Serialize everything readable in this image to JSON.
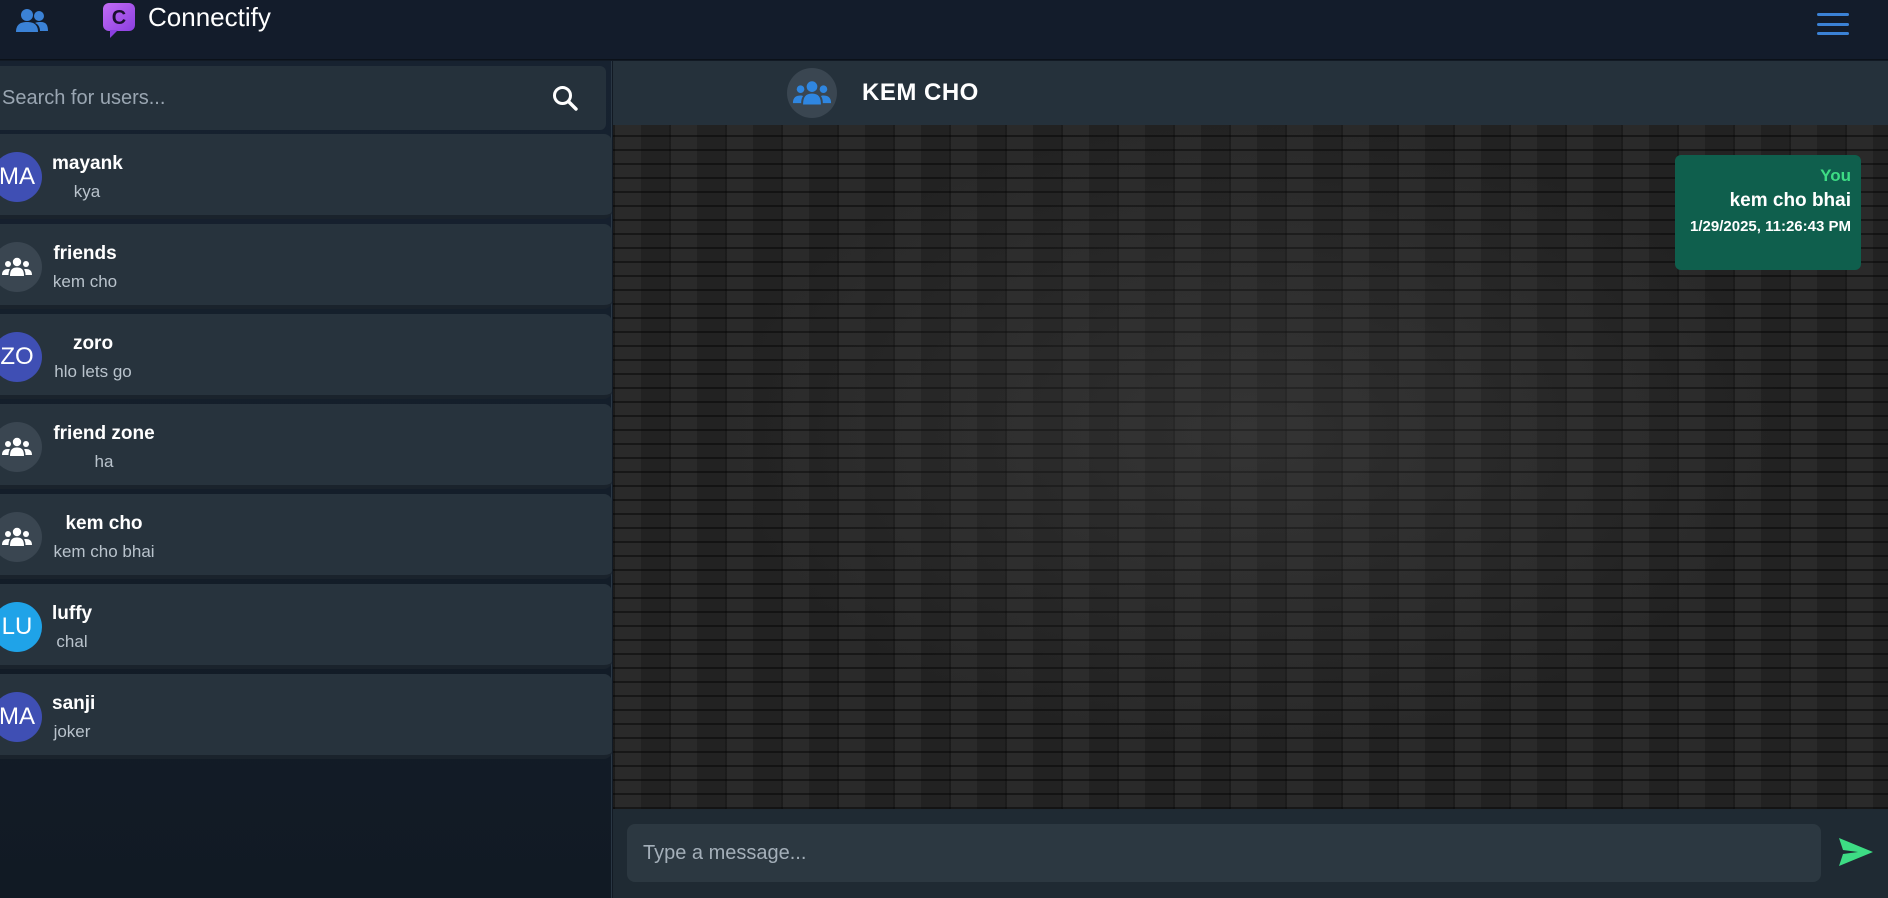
{
  "app": {
    "title": "Connectify",
    "logo_letter": "C",
    "accent_color": "#3b82d6",
    "logo_color": "#a855f7"
  },
  "search": {
    "placeholder": "Search for users..."
  },
  "chats": [
    {
      "name": "mayank",
      "last_message": "kya",
      "avatar_text": "MA",
      "kind": "user"
    },
    {
      "name": "friends",
      "last_message": "kem cho",
      "avatar_text": "",
      "kind": "group"
    },
    {
      "name": "zoro",
      "last_message": "hlo lets go",
      "avatar_text": "ZO",
      "kind": "user"
    },
    {
      "name": "friend zone",
      "last_message": "ha",
      "avatar_text": "",
      "kind": "group"
    },
    {
      "name": "kem cho",
      "last_message": "kem cho bhai",
      "avatar_text": "",
      "kind": "group"
    },
    {
      "name": "luffy",
      "last_message": "chal",
      "avatar_text": "LU",
      "kind": "user"
    },
    {
      "name": "sanji",
      "last_message": "joker",
      "avatar_text": "MA",
      "kind": "user"
    }
  ],
  "active_chat": {
    "title": "KEM CHO",
    "messages": [
      {
        "sender": "You",
        "text": "kem cho bhai",
        "timestamp": "1/29/2025, 11:26:43 PM"
      }
    ]
  },
  "composer": {
    "placeholder": "Type a message..."
  },
  "icons": {
    "users": "users-icon",
    "menu": "hamburger-menu-icon",
    "search": "search-icon",
    "group": "group-icon",
    "send": "send-icon"
  },
  "colors": {
    "bubble_bg": "#0f5f4d",
    "sender_label": "#3ddc84",
    "send_icon": "#3ddc84"
  }
}
